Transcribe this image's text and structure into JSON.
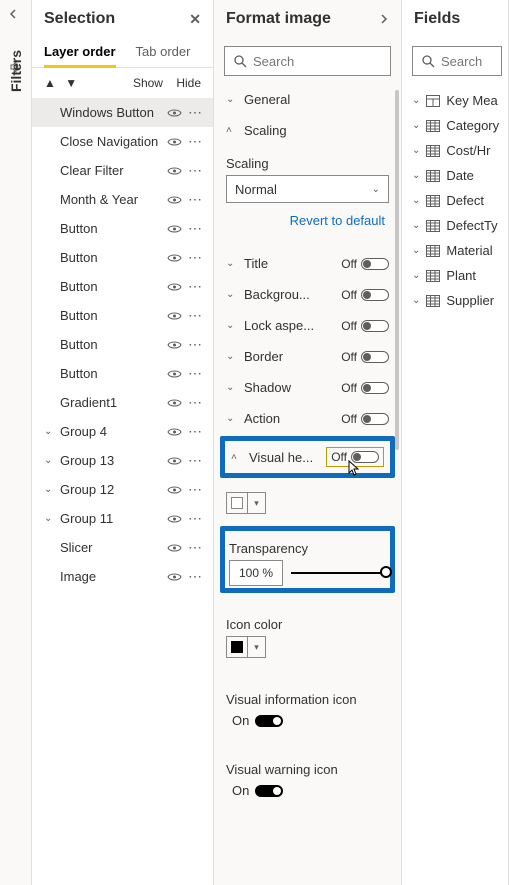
{
  "rail": {
    "filters_label": "Filters"
  },
  "selection": {
    "title": "Selection",
    "tabs": {
      "layer": "Layer order",
      "tab": "Tab order"
    },
    "controls": {
      "show": "Show",
      "hide": "Hide"
    },
    "items": [
      {
        "label": "Windows Button",
        "selected": true
      },
      {
        "label": "Close Navigation"
      },
      {
        "label": "Clear Filter"
      },
      {
        "label": "Month & Year"
      },
      {
        "label": "Button"
      },
      {
        "label": "Button"
      },
      {
        "label": "Button"
      },
      {
        "label": "Button"
      },
      {
        "label": "Button"
      },
      {
        "label": "Button"
      },
      {
        "label": "Gradient1"
      },
      {
        "label": "Group 4",
        "group": true
      },
      {
        "label": "Group 13",
        "group": true
      },
      {
        "label": "Group 12",
        "group": true
      },
      {
        "label": "Group 11",
        "group": true
      },
      {
        "label": "Slicer"
      },
      {
        "label": "Image"
      }
    ]
  },
  "format": {
    "title": "Format image",
    "search_placeholder": "Search",
    "general_label": "General",
    "scaling_section": {
      "title": "Scaling",
      "field_label": "Scaling",
      "value": "Normal",
      "revert": "Revert to default"
    },
    "rows": [
      {
        "label": "Title",
        "state": "Off"
      },
      {
        "label": "Backgrou...",
        "state": "Off"
      },
      {
        "label": "Lock aspe...",
        "state": "Off"
      },
      {
        "label": "Border",
        "state": "Off"
      },
      {
        "label": "Shadow",
        "state": "Off"
      },
      {
        "label": "Action",
        "state": "Off"
      }
    ],
    "visual_header": {
      "label": "Visual he...",
      "state": "Off"
    },
    "transparency": {
      "label": "Transparency",
      "value": "100 %"
    },
    "icon_color": {
      "label": "Icon color",
      "value": "#000000"
    },
    "vis_info": {
      "label": "Visual information icon",
      "state": "On"
    },
    "vis_warn": {
      "label": "Visual warning icon",
      "state": "On"
    }
  },
  "fields": {
    "title": "Fields",
    "search_placeholder": "Search",
    "items": [
      {
        "label": "Key Mea",
        "icon": "measure"
      },
      {
        "label": "Category",
        "icon": "table"
      },
      {
        "label": "Cost/Hr",
        "icon": "table"
      },
      {
        "label": "Date",
        "icon": "table"
      },
      {
        "label": "Defect",
        "icon": "table"
      },
      {
        "label": "DefectTy",
        "icon": "table"
      },
      {
        "label": "Material",
        "icon": "table"
      },
      {
        "label": "Plant",
        "icon": "table"
      },
      {
        "label": "Supplier",
        "icon": "table"
      }
    ]
  }
}
